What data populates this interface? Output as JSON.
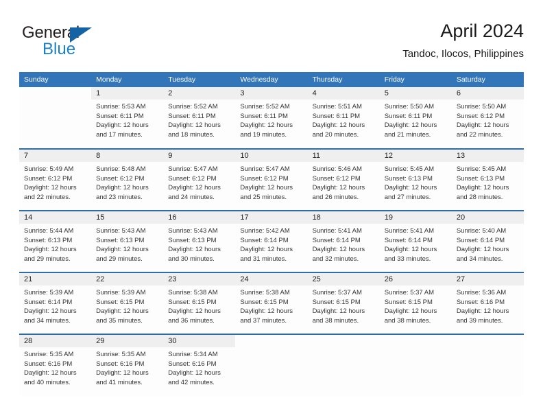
{
  "brand": {
    "name_part1": "General",
    "name_part2": "Blue"
  },
  "header": {
    "title": "April 2024",
    "subtitle": "Tandoc, Ilocos, Philippines"
  },
  "colors": {
    "header_blue": "#3275b8",
    "row_divider_blue": "#2e6da4",
    "daynum_band": "#efefef",
    "brand_blue": "#1b7fc4"
  },
  "weekdays": [
    "Sunday",
    "Monday",
    "Tuesday",
    "Wednesday",
    "Thursday",
    "Friday",
    "Saturday"
  ],
  "labels": {
    "sunrise_prefix": "Sunrise:",
    "sunset_prefix": "Sunset:",
    "daylight_prefix": "Daylight:"
  },
  "weeks": [
    [
      {
        "day": "",
        "sunrise": "",
        "sunset": "",
        "daylight_line1": "",
        "daylight_line2": ""
      },
      {
        "day": "1",
        "sunrise": "Sunrise: 5:53 AM",
        "sunset": "Sunset: 6:11 PM",
        "daylight_line1": "Daylight: 12 hours",
        "daylight_line2": "and 17 minutes."
      },
      {
        "day": "2",
        "sunrise": "Sunrise: 5:52 AM",
        "sunset": "Sunset: 6:11 PM",
        "daylight_line1": "Daylight: 12 hours",
        "daylight_line2": "and 18 minutes."
      },
      {
        "day": "3",
        "sunrise": "Sunrise: 5:52 AM",
        "sunset": "Sunset: 6:11 PM",
        "daylight_line1": "Daylight: 12 hours",
        "daylight_line2": "and 19 minutes."
      },
      {
        "day": "4",
        "sunrise": "Sunrise: 5:51 AM",
        "sunset": "Sunset: 6:11 PM",
        "daylight_line1": "Daylight: 12 hours",
        "daylight_line2": "and 20 minutes."
      },
      {
        "day": "5",
        "sunrise": "Sunrise: 5:50 AM",
        "sunset": "Sunset: 6:11 PM",
        "daylight_line1": "Daylight: 12 hours",
        "daylight_line2": "and 21 minutes."
      },
      {
        "day": "6",
        "sunrise": "Sunrise: 5:50 AM",
        "sunset": "Sunset: 6:12 PM",
        "daylight_line1": "Daylight: 12 hours",
        "daylight_line2": "and 22 minutes."
      }
    ],
    [
      {
        "day": "7",
        "sunrise": "Sunrise: 5:49 AM",
        "sunset": "Sunset: 6:12 PM",
        "daylight_line1": "Daylight: 12 hours",
        "daylight_line2": "and 22 minutes."
      },
      {
        "day": "8",
        "sunrise": "Sunrise: 5:48 AM",
        "sunset": "Sunset: 6:12 PM",
        "daylight_line1": "Daylight: 12 hours",
        "daylight_line2": "and 23 minutes."
      },
      {
        "day": "9",
        "sunrise": "Sunrise: 5:47 AM",
        "sunset": "Sunset: 6:12 PM",
        "daylight_line1": "Daylight: 12 hours",
        "daylight_line2": "and 24 minutes."
      },
      {
        "day": "10",
        "sunrise": "Sunrise: 5:47 AM",
        "sunset": "Sunset: 6:12 PM",
        "daylight_line1": "Daylight: 12 hours",
        "daylight_line2": "and 25 minutes."
      },
      {
        "day": "11",
        "sunrise": "Sunrise: 5:46 AM",
        "sunset": "Sunset: 6:12 PM",
        "daylight_line1": "Daylight: 12 hours",
        "daylight_line2": "and 26 minutes."
      },
      {
        "day": "12",
        "sunrise": "Sunrise: 5:45 AM",
        "sunset": "Sunset: 6:13 PM",
        "daylight_line1": "Daylight: 12 hours",
        "daylight_line2": "and 27 minutes."
      },
      {
        "day": "13",
        "sunrise": "Sunrise: 5:45 AM",
        "sunset": "Sunset: 6:13 PM",
        "daylight_line1": "Daylight: 12 hours",
        "daylight_line2": "and 28 minutes."
      }
    ],
    [
      {
        "day": "14",
        "sunrise": "Sunrise: 5:44 AM",
        "sunset": "Sunset: 6:13 PM",
        "daylight_line1": "Daylight: 12 hours",
        "daylight_line2": "and 29 minutes."
      },
      {
        "day": "15",
        "sunrise": "Sunrise: 5:43 AM",
        "sunset": "Sunset: 6:13 PM",
        "daylight_line1": "Daylight: 12 hours",
        "daylight_line2": "and 29 minutes."
      },
      {
        "day": "16",
        "sunrise": "Sunrise: 5:43 AM",
        "sunset": "Sunset: 6:13 PM",
        "daylight_line1": "Daylight: 12 hours",
        "daylight_line2": "and 30 minutes."
      },
      {
        "day": "17",
        "sunrise": "Sunrise: 5:42 AM",
        "sunset": "Sunset: 6:14 PM",
        "daylight_line1": "Daylight: 12 hours",
        "daylight_line2": "and 31 minutes."
      },
      {
        "day": "18",
        "sunrise": "Sunrise: 5:41 AM",
        "sunset": "Sunset: 6:14 PM",
        "daylight_line1": "Daylight: 12 hours",
        "daylight_line2": "and 32 minutes."
      },
      {
        "day": "19",
        "sunrise": "Sunrise: 5:41 AM",
        "sunset": "Sunset: 6:14 PM",
        "daylight_line1": "Daylight: 12 hours",
        "daylight_line2": "and 33 minutes."
      },
      {
        "day": "20",
        "sunrise": "Sunrise: 5:40 AM",
        "sunset": "Sunset: 6:14 PM",
        "daylight_line1": "Daylight: 12 hours",
        "daylight_line2": "and 34 minutes."
      }
    ],
    [
      {
        "day": "21",
        "sunrise": "Sunrise: 5:39 AM",
        "sunset": "Sunset: 6:14 PM",
        "daylight_line1": "Daylight: 12 hours",
        "daylight_line2": "and 34 minutes."
      },
      {
        "day": "22",
        "sunrise": "Sunrise: 5:39 AM",
        "sunset": "Sunset: 6:15 PM",
        "daylight_line1": "Daylight: 12 hours",
        "daylight_line2": "and 35 minutes."
      },
      {
        "day": "23",
        "sunrise": "Sunrise: 5:38 AM",
        "sunset": "Sunset: 6:15 PM",
        "daylight_line1": "Daylight: 12 hours",
        "daylight_line2": "and 36 minutes."
      },
      {
        "day": "24",
        "sunrise": "Sunrise: 5:38 AM",
        "sunset": "Sunset: 6:15 PM",
        "daylight_line1": "Daylight: 12 hours",
        "daylight_line2": "and 37 minutes."
      },
      {
        "day": "25",
        "sunrise": "Sunrise: 5:37 AM",
        "sunset": "Sunset: 6:15 PM",
        "daylight_line1": "Daylight: 12 hours",
        "daylight_line2": "and 38 minutes."
      },
      {
        "day": "26",
        "sunrise": "Sunrise: 5:37 AM",
        "sunset": "Sunset: 6:15 PM",
        "daylight_line1": "Daylight: 12 hours",
        "daylight_line2": "and 38 minutes."
      },
      {
        "day": "27",
        "sunrise": "Sunrise: 5:36 AM",
        "sunset": "Sunset: 6:16 PM",
        "daylight_line1": "Daylight: 12 hours",
        "daylight_line2": "and 39 minutes."
      }
    ],
    [
      {
        "day": "28",
        "sunrise": "Sunrise: 5:35 AM",
        "sunset": "Sunset: 6:16 PM",
        "daylight_line1": "Daylight: 12 hours",
        "daylight_line2": "and 40 minutes."
      },
      {
        "day": "29",
        "sunrise": "Sunrise: 5:35 AM",
        "sunset": "Sunset: 6:16 PM",
        "daylight_line1": "Daylight: 12 hours",
        "daylight_line2": "and 41 minutes."
      },
      {
        "day": "30",
        "sunrise": "Sunrise: 5:34 AM",
        "sunset": "Sunset: 6:16 PM",
        "daylight_line1": "Daylight: 12 hours",
        "daylight_line2": "and 42 minutes."
      },
      {
        "day": "",
        "sunrise": "",
        "sunset": "",
        "daylight_line1": "",
        "daylight_line2": ""
      },
      {
        "day": "",
        "sunrise": "",
        "sunset": "",
        "daylight_line1": "",
        "daylight_line2": ""
      },
      {
        "day": "",
        "sunrise": "",
        "sunset": "",
        "daylight_line1": "",
        "daylight_line2": ""
      },
      {
        "day": "",
        "sunrise": "",
        "sunset": "",
        "daylight_line1": "",
        "daylight_line2": ""
      }
    ]
  ]
}
